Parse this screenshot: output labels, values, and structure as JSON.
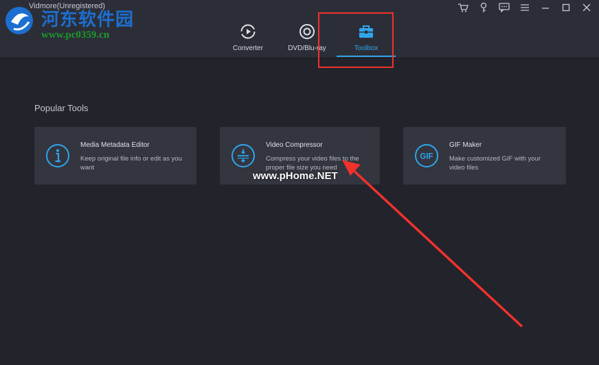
{
  "app": {
    "title": "Vidmore(Unregistered)"
  },
  "watermark": {
    "site_cn": "河东软件园",
    "site_url": "www.pc0359.cn",
    "overlay": "www.pHome.NET"
  },
  "window_controls": [
    "cart-icon",
    "key-icon",
    "feedback-icon",
    "menu-icon",
    "minimize-icon",
    "maximize-icon",
    "close-icon"
  ],
  "tabs": [
    {
      "label": "Converter",
      "icon": "converter-icon",
      "active": false
    },
    {
      "label": "DVD/Blu-ray",
      "icon": "disc-icon",
      "active": false
    },
    {
      "label": "Toolbox",
      "icon": "toolbox-icon",
      "active": true
    }
  ],
  "main": {
    "section_title": "Popular Tools",
    "tools": [
      {
        "title": "Media Metadata Editor",
        "desc": "Keep original file info or edit as you want",
        "icon": "info-icon"
      },
      {
        "title": "Video Compressor",
        "desc": "Compress your video files to the proper file size you need",
        "icon": "compress-icon"
      },
      {
        "title": "GIF Maker",
        "desc": "Make customized GIF with your video files",
        "icon": "gif-icon"
      }
    ]
  },
  "colors": {
    "accent": "#2fa6ec",
    "annotation": "#f0322d",
    "background": "#22232b",
    "card": "#33353f"
  }
}
